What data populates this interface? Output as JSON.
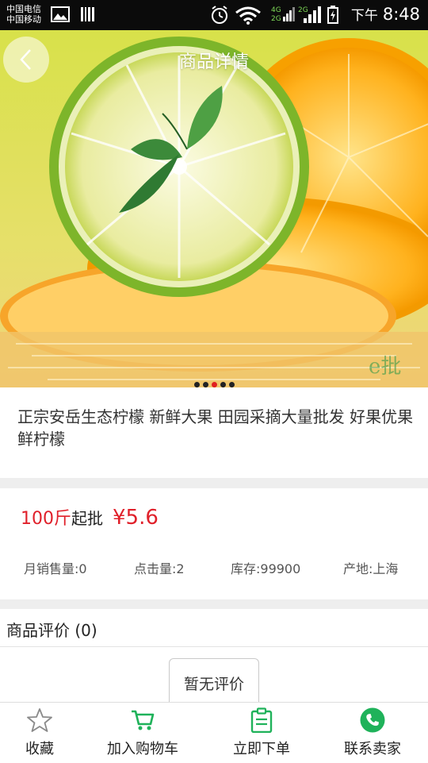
{
  "status_bar": {
    "carrier_1": "中国电信",
    "carrier_2": "中国移动",
    "network_1": "4G",
    "network_2": "2G",
    "network_3": "2G",
    "ampm": "下午",
    "time": "8:48"
  },
  "header": {
    "title": "商品详情",
    "back_icon": "chevron-left-icon"
  },
  "carousel": {
    "image": "lemon-slices-photo",
    "watermark": "e批",
    "slide_count": 5,
    "active_index": 2
  },
  "product": {
    "title": "正宗安岳生态柠檬 新鲜大果 田园采摘大量批发  好果优果鲜柠檬"
  },
  "pricing": {
    "min_qty": "100斤",
    "min_qty_suffix": "起批",
    "price": "¥5.6"
  },
  "stats": {
    "monthly_sales": "月销售量:0",
    "clicks": "点击量:2",
    "stock": "库存:99900",
    "origin": "产地:上海"
  },
  "reviews": {
    "header": "商品评价 (0)",
    "empty_text": "暂无评价"
  },
  "bottom_nav": {
    "items": [
      {
        "label": "收藏",
        "icon": "star-outline-icon"
      },
      {
        "label": "加入购物车",
        "icon": "cart-icon"
      },
      {
        "label": "立即下单",
        "icon": "clipboard-icon"
      },
      {
        "label": "联系卖家",
        "icon": "phone-icon"
      }
    ]
  },
  "colors": {
    "accent_green": "#1fb25a",
    "price_red": "#e0202a",
    "statusbar_bg": "#0b0b0b"
  }
}
